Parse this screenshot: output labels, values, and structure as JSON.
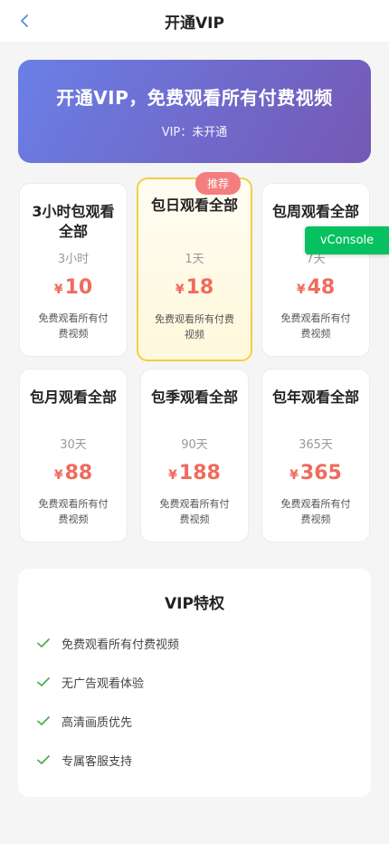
{
  "header": {
    "title": "开通VIP",
    "back_icon": "chevron-left-icon"
  },
  "banner": {
    "title": "开通VIP，免费观看所有付费视频",
    "status": "VIP：未开通",
    "gradient": [
      "#6a7fe6",
      "#7558b4"
    ]
  },
  "currency_symbol": "¥",
  "plans": [
    {
      "name": "3小时包观看全部",
      "duration": "3小时",
      "price": "10",
      "desc": "免费观看所有付费视频"
    },
    {
      "name": "包日观看全部",
      "duration": "1天",
      "price": "18",
      "desc": "免费观看所有付费视频",
      "selected": true,
      "badge": "推荐"
    },
    {
      "name": "包周观看全部",
      "duration": "7天",
      "price": "48",
      "desc": "免费观看所有付费视频"
    },
    {
      "name": "包月观看全部",
      "duration": "30天",
      "price": "88",
      "desc": "免费观看所有付费视频"
    },
    {
      "name": "包季观看全部",
      "duration": "90天",
      "price": "188",
      "desc": "免费观看所有付费视频"
    },
    {
      "name": "包年观看全部",
      "duration": "365天",
      "price": "365",
      "desc": "免费观看所有付费视频"
    }
  ],
  "vconsole": {
    "label": "vConsole"
  },
  "privileges": {
    "title": "VIP特权",
    "items": [
      {
        "label": "免费观看所有付费视频",
        "icon": "check-icon"
      },
      {
        "label": "无广告观看体验",
        "icon": "check-icon"
      },
      {
        "label": "高清画质优先",
        "icon": "check-icon"
      },
      {
        "label": "专属客服支持",
        "icon": "check-icon"
      }
    ]
  },
  "colors": {
    "price": "#ef6b5e",
    "selected_border": "#f3cf3e",
    "badge": "#f47d7d",
    "check": "#4caf50",
    "vconsole": "#07c160"
  }
}
